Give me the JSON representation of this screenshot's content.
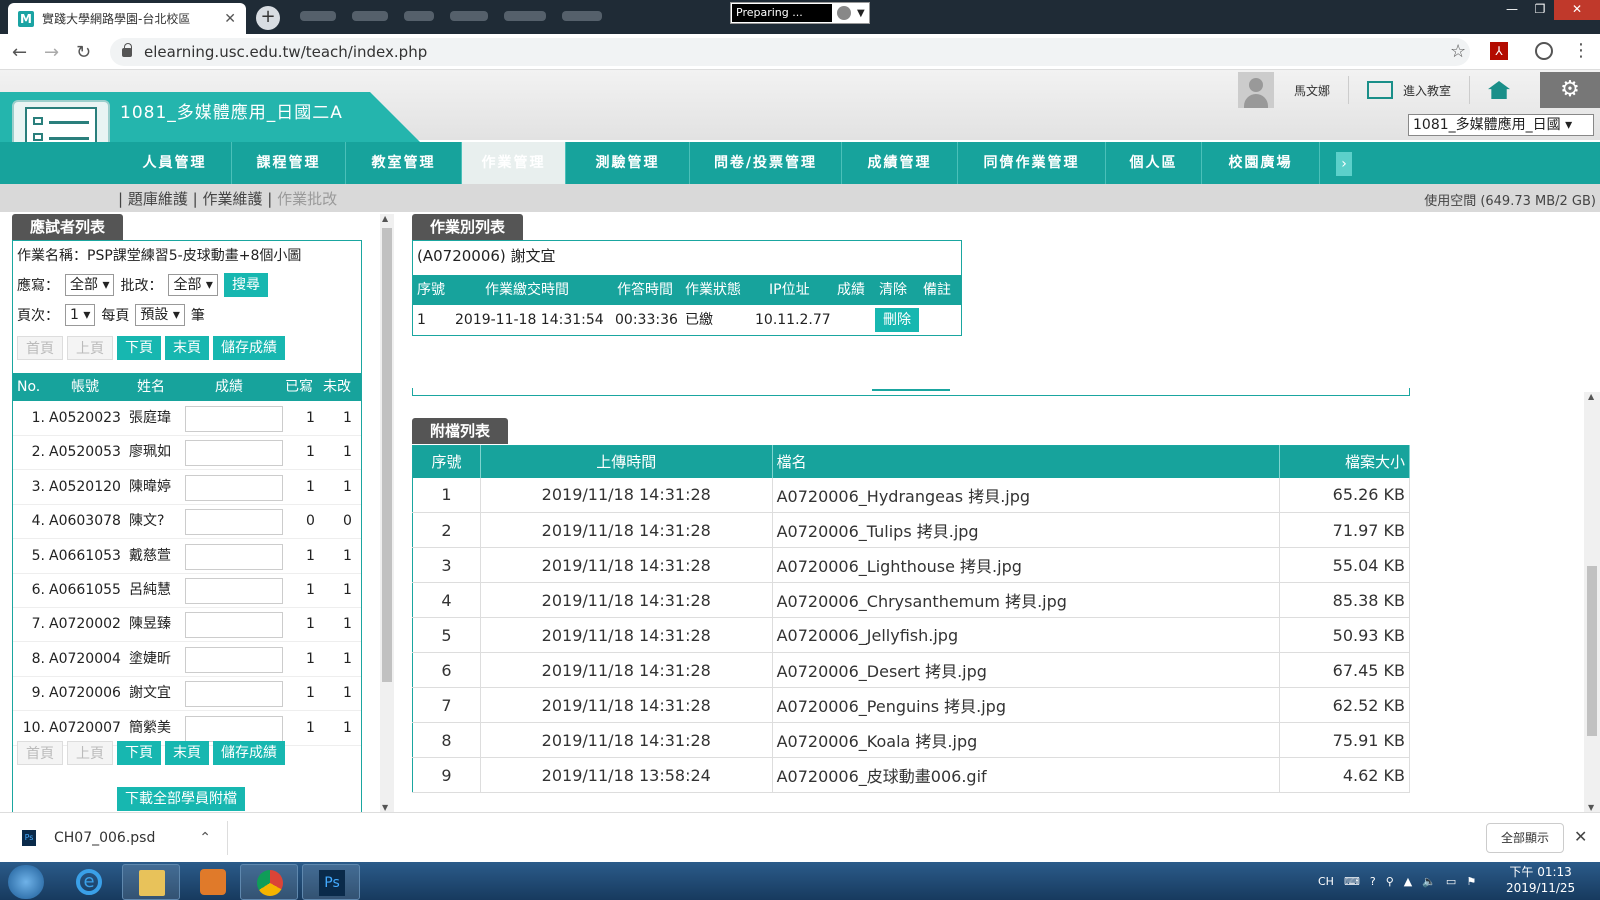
{
  "browser": {
    "tab_title": "實踐大學網路學園-台北校區",
    "tab_favicon": "M",
    "preparing": "Preparing ...",
    "url": "elearning.usc.edu.tw/teach/index.php"
  },
  "site": {
    "course_title": "1081_多媒體應用_日國二A",
    "user_name": "馬文娜",
    "enter_classroom": "進入教室",
    "course_select": "1081_多媒體應用_日國"
  },
  "nav": {
    "items": [
      "人員管理",
      "課程管理",
      "教室管理",
      "作業管理",
      "測驗管理",
      "問卷/投票管理",
      "成績管理",
      "同儕作業管理",
      "個人區",
      "校園廣場"
    ],
    "more": "›"
  },
  "subnav": {
    "links": [
      "題庫維護",
      "作業維護",
      "作業批改"
    ],
    "quota": "使用空間 (649.73 MB/2 GB)"
  },
  "left": {
    "panel_title": "應試者列表",
    "assignment_name": "作業名稱：PSP課堂練習5-皮球動畫+8個小圖",
    "filter_write_label": "應寫：",
    "filter_write_value": "全部",
    "filter_grade_label": "批改：",
    "filter_grade_value": "全部",
    "search_btn": "搜尋",
    "page_label": "頁次：",
    "page_value": "1",
    "per_page_label": "每頁",
    "per_page_value": "預設",
    "per_page_unit": "筆",
    "pager": {
      "first": "首頁",
      "prev": "上頁",
      "next": "下頁",
      "last": "末頁",
      "save": "儲存成績"
    },
    "columns": {
      "no": "No.",
      "account": "帳號",
      "name": "姓名",
      "score": "成績",
      "written": "已寫",
      "ungraded": "未改"
    },
    "students": [
      {
        "no": "1.",
        "account": "A0520023",
        "name": "張庭瑋",
        "written": "1",
        "ungraded": "1"
      },
      {
        "no": "2.",
        "account": "A0520053",
        "name": "廖珮如",
        "written": "1",
        "ungraded": "1"
      },
      {
        "no": "3.",
        "account": "A0520120",
        "name": "陳暐婷",
        "written": "1",
        "ungraded": "1"
      },
      {
        "no": "4.",
        "account": "A0603078",
        "name": "陳文?",
        "written": "0",
        "ungraded": "0"
      },
      {
        "no": "5.",
        "account": "A0661053",
        "name": "戴慈萱",
        "written": "1",
        "ungraded": "1"
      },
      {
        "no": "6.",
        "account": "A0661055",
        "name": "呂純慧",
        "written": "1",
        "ungraded": "1"
      },
      {
        "no": "7.",
        "account": "A0720002",
        "name": "陳昱臻",
        "written": "1",
        "ungraded": "1"
      },
      {
        "no": "8.",
        "account": "A0720004",
        "name": "塗婕昕",
        "written": "1",
        "ungraded": "1"
      },
      {
        "no": "9.",
        "account": "A0720006",
        "name": "謝文宜",
        "written": "1",
        "ungraded": "1"
      },
      {
        "no": "10.",
        "account": "A0720007",
        "name": "簡縈美",
        "written": "1",
        "ungraded": "1"
      }
    ],
    "download_all": "下載全部學員附檔"
  },
  "submission": {
    "panel_title": "作業別列表",
    "student": "(A0720006) 謝文宜",
    "columns": {
      "no": "序號",
      "submit_time": "作業繳交時間",
      "duration": "作答時間",
      "status": "作業狀態",
      "ip": "IP位址",
      "score": "成績",
      "clear": "清除",
      "note": "備註"
    },
    "row": {
      "no": "1",
      "submit_time": "2019-11-18 14:31:54",
      "duration": "00:33:36",
      "status": "已繳",
      "ip": "10.11.2.77",
      "delete": "刪除"
    }
  },
  "attachments": {
    "panel_title": "附檔列表",
    "columns": {
      "no": "序號",
      "upload_time": "上傳時間",
      "filename": "檔名",
      "size": "檔案大小"
    },
    "files": [
      {
        "no": "1",
        "time": "2019/11/18 14:31:28",
        "name": "A0720006_Hydrangeas 拷貝.jpg",
        "size": "65.26 KB"
      },
      {
        "no": "2",
        "time": "2019/11/18 14:31:28",
        "name": "A0720006_Tulips 拷貝.jpg",
        "size": "71.97 KB"
      },
      {
        "no": "3",
        "time": "2019/11/18 14:31:28",
        "name": "A0720006_Lighthouse 拷貝.jpg",
        "size": "55.04 KB"
      },
      {
        "no": "4",
        "time": "2019/11/18 14:31:28",
        "name": "A0720006_Chrysanthemum 拷貝.jpg",
        "size": "85.38 KB"
      },
      {
        "no": "5",
        "time": "2019/11/18 14:31:28",
        "name": "A0720006_Jellyfish.jpg",
        "size": "50.93 KB"
      },
      {
        "no": "6",
        "time": "2019/11/18 14:31:28",
        "name": "A0720006_Desert 拷貝.jpg",
        "size": "67.45 KB"
      },
      {
        "no": "7",
        "time": "2019/11/18 14:31:28",
        "name": "A0720006_Penguins 拷貝.jpg",
        "size": "62.52 KB"
      },
      {
        "no": "8",
        "time": "2019/11/18 14:31:28",
        "name": "A0720006_Koala 拷貝.jpg",
        "size": "75.91 KB"
      },
      {
        "no": "9",
        "time": "2019/11/18 13:58:24",
        "name": "A0720006_皮球動畫006.gif",
        "size": "4.62 KB"
      }
    ]
  },
  "download_bar": {
    "file": "CH07_006.psd",
    "show_all": "全部顯示"
  },
  "taskbar": {
    "lang": "CH",
    "time": "下午 01:13",
    "date": "2019/11/25"
  },
  "colors": {
    "teal": "#17a39c",
    "teal_button": "#17b7b0",
    "panel_label": "#555555"
  }
}
